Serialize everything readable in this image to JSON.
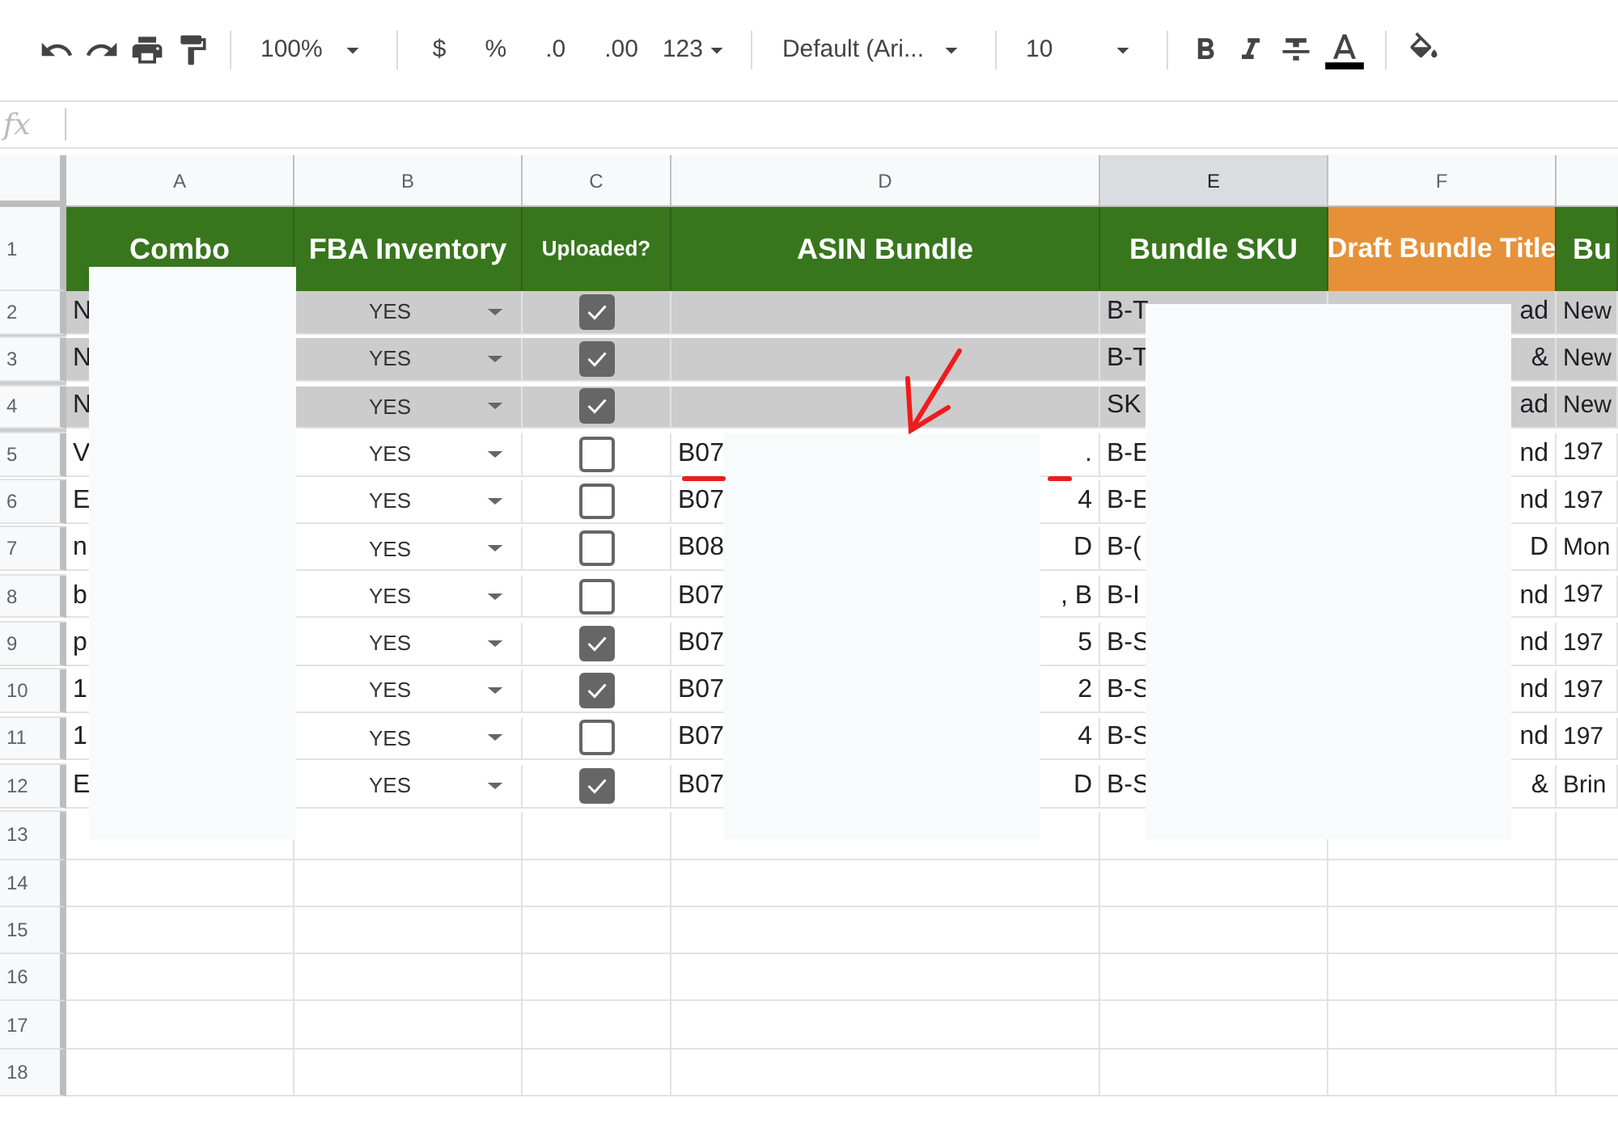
{
  "toolbar": {
    "zoom": "100%",
    "currency": "$",
    "percent": "%",
    "decrease_decimals": ".0",
    "increase_decimals": ".00",
    "more_formats": "123",
    "font": "Default (Ari...",
    "font_size": "10"
  },
  "formula_bar": {
    "label": "fx"
  },
  "columns": [
    {
      "letter": "A",
      "selected": false
    },
    {
      "letter": "B",
      "selected": false
    },
    {
      "letter": "C",
      "selected": false
    },
    {
      "letter": "D",
      "selected": false
    },
    {
      "letter": "E",
      "selected": true
    },
    {
      "letter": "F",
      "selected": false
    }
  ],
  "header_row": {
    "number": "1",
    "cells": [
      {
        "text": "Combo",
        "color": "#38761d"
      },
      {
        "text": "FBA Inventory",
        "color": "#38761d"
      },
      {
        "text": "Uploaded?",
        "color": "#38761d"
      },
      {
        "text": "ASIN Bundle",
        "color": "#38761d"
      },
      {
        "text": "Bundle SKU",
        "color": "#38761d"
      },
      {
        "text": "Draft Bundle Title",
        "color": "#e69138"
      },
      {
        "text": "Bu",
        "color": "#38761d"
      }
    ]
  },
  "rows": [
    {
      "number": "2",
      "highlighted": true,
      "combo": "N",
      "fba_inventory": "YES",
      "uploaded": true,
      "asin_start": "",
      "asin_end": "",
      "bundle_sku": "B-T",
      "title_end": "ad",
      "column_7": "New"
    },
    {
      "number": "3",
      "highlighted": true,
      "combo": "N",
      "fba_inventory": "YES",
      "uploaded": true,
      "asin_start": "",
      "asin_end": "",
      "bundle_sku": "B-T",
      "title_end": "&",
      "column_7": "New"
    },
    {
      "number": "4",
      "highlighted": true,
      "combo": "N",
      "fba_inventory": "YES",
      "uploaded": true,
      "asin_start": "",
      "asin_end": "",
      "bundle_sku": "SK",
      "title_end": "ad",
      "column_7": "New"
    },
    {
      "number": "5",
      "highlighted": false,
      "combo": "V",
      "fba_inventory": "YES",
      "uploaded": false,
      "asin_start": "B07",
      "asin_end": ".",
      "bundle_sku": "B-E",
      "title_end": "nd",
      "column_7": "197"
    },
    {
      "number": "6",
      "highlighted": false,
      "combo": "E",
      "fba_inventory": "YES",
      "uploaded": false,
      "asin_start": "B07",
      "asin_end": "4",
      "bundle_sku": "B-E",
      "title_end": "nd",
      "column_7": "197"
    },
    {
      "number": "7",
      "highlighted": false,
      "combo": "n",
      "fba_inventory": "YES",
      "uploaded": false,
      "asin_start": "B08",
      "asin_end": "D",
      "bundle_sku": "B-(",
      "title_end": "D",
      "column_7": "Mon"
    },
    {
      "number": "8",
      "highlighted": false,
      "combo": "b",
      "fba_inventory": "YES",
      "uploaded": false,
      "asin_start": "B07",
      "asin_end": ", B",
      "bundle_sku": "B-I",
      "title_end": "nd",
      "column_7": "197"
    },
    {
      "number": "9",
      "highlighted": false,
      "combo": "p",
      "fba_inventory": "YES",
      "uploaded": true,
      "asin_start": "B07",
      "asin_end": "5",
      "bundle_sku": "B-S",
      "title_end": "nd",
      "column_7": "197"
    },
    {
      "number": "10",
      "highlighted": false,
      "combo": "1",
      "fba_inventory": "YES",
      "uploaded": true,
      "asin_start": "B07",
      "asin_end": "2",
      "bundle_sku": "B-S",
      "title_end": "nd",
      "column_7": "197"
    },
    {
      "number": "11",
      "highlighted": false,
      "combo": "1",
      "fba_inventory": "YES",
      "uploaded": false,
      "asin_start": "B07",
      "asin_end": "4",
      "bundle_sku": "B-S",
      "title_end": "nd",
      "column_7": "197"
    },
    {
      "number": "12",
      "highlighted": false,
      "combo": "E",
      "fba_inventory": "YES",
      "uploaded": true,
      "asin_start": "B07",
      "asin_end": "D",
      "bundle_sku": "B-S",
      "title_end": "&",
      "column_7": "Brin"
    }
  ],
  "empty_rows": [
    "13",
    "14",
    "15",
    "16",
    "17",
    "18"
  ]
}
